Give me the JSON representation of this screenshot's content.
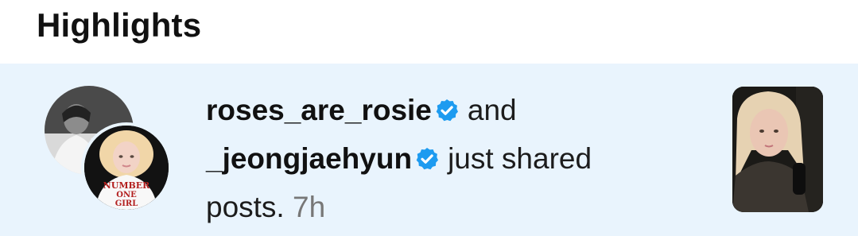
{
  "section": {
    "title": "Highlights"
  },
  "notification": {
    "user1": "roses_are_rosie",
    "connector": "and",
    "user2": "_jeongjaehyun",
    "message_part1": "just shared",
    "message_part2": "posts.",
    "time": "7h",
    "shirt_text": [
      "NUMBER",
      "ONE",
      "GIRL"
    ],
    "icons": {
      "verified": "verified-badge-icon"
    },
    "colors": {
      "background": "#e9f4fd",
      "verified": "#1d9bf0",
      "time": "#777777"
    }
  }
}
